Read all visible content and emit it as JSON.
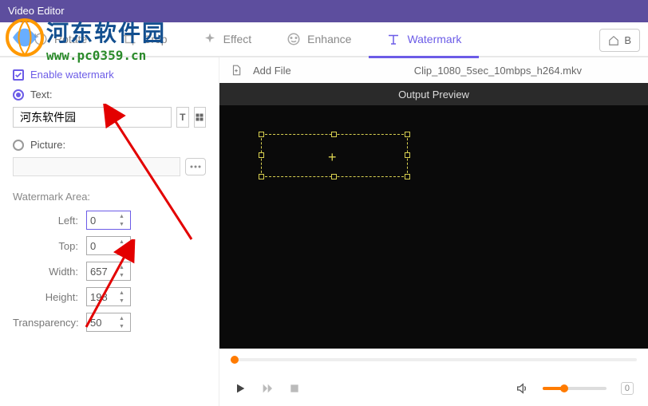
{
  "titlebar": {
    "title": "Video Editor"
  },
  "tabs": {
    "rotate": "Rotate",
    "crop": "Crop",
    "effect": "Effect",
    "enhance": "Enhance",
    "watermark": "Watermark"
  },
  "back_button": "B",
  "sidebar": {
    "enable_label": "Enable watermark",
    "text_label": "Text:",
    "text_value": "河东软件园",
    "picture_label": "Picture:",
    "area_title": "Watermark Area:",
    "left_label": "Left:",
    "left_value": "0",
    "top_label": "Top:",
    "top_value": "0",
    "width_label": "Width:",
    "width_value": "657",
    "height_label": "Height:",
    "height_value": "198",
    "transparency_label": "Transparency:",
    "transparency_value": "50"
  },
  "file": {
    "add_label": "Add File",
    "name": "Clip_1080_5sec_10mbps_h264.mkv"
  },
  "preview": {
    "title": "Output Preview"
  },
  "controls": {
    "time": "0"
  },
  "overlay": {
    "site_cn": "河东软件园",
    "site_url": "www.pc0359.cn"
  }
}
